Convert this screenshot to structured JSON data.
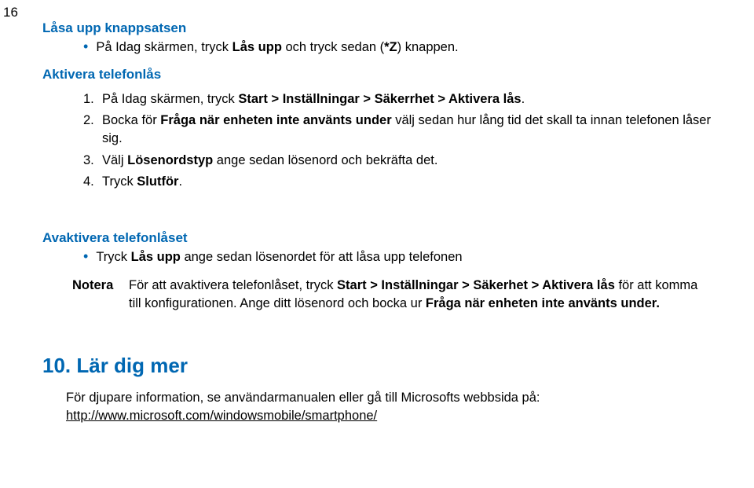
{
  "pageNumber": "16",
  "sec1": {
    "title": "Låsa upp knappsatsen",
    "bullet_pre": "På Idag skärmen, tryck ",
    "bullet_b1": "Lås upp",
    "bullet_mid": " och tryck sedan (",
    "bullet_b2": "*Z",
    "bullet_post": ") knappen."
  },
  "sec2": {
    "title": "Aktivera telefonlås",
    "items": [
      {
        "num": "1.",
        "pre": "På Idag skärmen, tryck ",
        "b": "Start > Inställningar > Säkerrhet > Aktivera lås",
        "post": "."
      },
      {
        "num": "2.",
        "pre": "Bocka för ",
        "b": "Fråga när enheten inte använts under",
        "post": " välj sedan hur lång tid det skall ta innan telefonen låser sig."
      },
      {
        "num": "3.",
        "pre": "Välj ",
        "b": "Lösenordstyp",
        "post": " ange sedan lösenord och bekräfta det."
      },
      {
        "num": "4.",
        "pre": "Tryck ",
        "b": "Slutför",
        "post": "."
      }
    ]
  },
  "sec3": {
    "title": "Avaktivera telefonlåset",
    "bullet_pre": "Tryck ",
    "bullet_b": "Lås upp",
    "bullet_post": " ange sedan lösenordet för att låsa upp telefonen",
    "note_label": "Notera",
    "note_pre": "För att avaktivera telefonlåset, tryck ",
    "note_b1": "Start > Inställningar > Säkerhet > Aktivera lås",
    "note_mid": " för att komma till konfigurationen. Ange ditt lösenord och bocka ur ",
    "note_b2": "Fråga när enheten inte använts under.",
    "note_post": ""
  },
  "sec4": {
    "heading": "10. Lär dig mer",
    "text": "För djupare information, se användarmanualen eller gå till Microsofts webbsida på:",
    "link": "http://www.microsoft.com/windowsmobile/smartphone/"
  }
}
